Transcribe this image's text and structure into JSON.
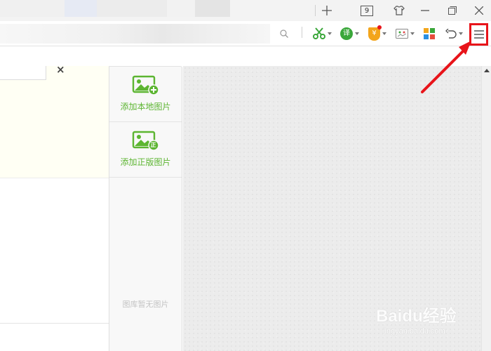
{
  "titlebar": {
    "tab_count": "9",
    "controls": [
      "new-tab",
      "tab-count",
      "skin",
      "minimize",
      "restore",
      "close"
    ]
  },
  "toolbar": {
    "search_icon": "search-icon",
    "tools": [
      "screenshot-scissors-icon",
      "translate-icon",
      "payment-shield-icon",
      "image-icon",
      "apps-grid-icon",
      "undo-icon",
      "menu-icon"
    ],
    "translate_glyph": "译",
    "payment_glyph": "¥"
  },
  "panel": {
    "add_local_image": "添加本地图片",
    "add_licensed_image": "添加正版图片",
    "licensed_badge": "正",
    "empty_text": "图库暂无图片"
  },
  "note": {
    "close_glyph": "×"
  },
  "watermark": {
    "brand": "Baidu",
    "brand_suffix": "经验",
    "url": "jingyan.baidu.com"
  },
  "colors": {
    "accent_green": "#5cb531",
    "highlight_red": "#e8141a"
  }
}
